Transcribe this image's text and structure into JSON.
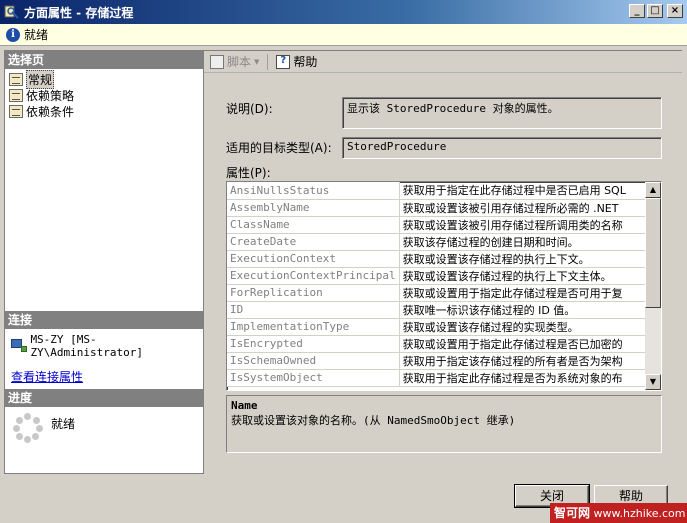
{
  "window": {
    "title": "方面属性 - 存储过程",
    "minimize": "_",
    "maximize": "□",
    "close": "×"
  },
  "status_bar": {
    "text": "就绪"
  },
  "left_panel": {
    "select_page_header": "选择页",
    "pages": [
      {
        "label": "常规",
        "selected": true
      },
      {
        "label": "依赖策略",
        "selected": false
      },
      {
        "label": "依赖条件",
        "selected": false
      }
    ],
    "connection_header": "连接",
    "connection_text": "MS-ZY [MS-ZY\\Administrator]",
    "view_connection_link": "查看连接属性",
    "progress_header": "进度",
    "progress_status": "就绪"
  },
  "toolbar": {
    "script_label": "脚本",
    "help_label": "帮助"
  },
  "form": {
    "description_label": "说明(D):",
    "description_value": "显示该 StoredProcedure 对象的属性。",
    "target_type_label": "适用的目标类型(A):",
    "target_type_value": "StoredProcedure",
    "properties_label": "属性(P):"
  },
  "properties": [
    {
      "name": "AnsiNullsStatus",
      "desc": "获取用于指定在此存储过程中是否已启用 SQL"
    },
    {
      "name": "AssemblyName",
      "desc": "获取或设置该被引用存储过程所必需的 .NET"
    },
    {
      "name": "ClassName",
      "desc": "获取或设置该被引用存储过程所调用类的名称"
    },
    {
      "name": "CreateDate",
      "desc": "获取该存储过程的创建日期和时间。"
    },
    {
      "name": "ExecutionContext",
      "desc": "获取或设置该存储过程的执行上下文。"
    },
    {
      "name": "ExecutionContextPrincipal",
      "desc": "获取或设置该存储过程的执行上下文主体。"
    },
    {
      "name": "ForReplication",
      "desc": "获取或设置用于指定此存储过程是否可用于复"
    },
    {
      "name": "ID",
      "desc": "获取唯一标识该存储过程的 ID 值。"
    },
    {
      "name": "ImplementationType",
      "desc": "获取或设置该存储过程的实现类型。"
    },
    {
      "name": "IsEncrypted",
      "desc": "获取或设置用于指定此存储过程是否已加密的"
    },
    {
      "name": "IsSchemaOwned",
      "desc": "获取用于指定该存储过程的所有者是否为架构"
    },
    {
      "name": "IsSystemObject",
      "desc": "获取用于指定此存储过程是否为系统对象的布"
    }
  ],
  "description_panel": {
    "name": "Name",
    "text": "获取或设置该对象的名称。(从 NamedSmoObject 继承)"
  },
  "buttons": {
    "close": "关闭",
    "help": "帮助"
  },
  "watermark": {
    "cn": "智可网",
    "url": "www.hzhike.com"
  }
}
